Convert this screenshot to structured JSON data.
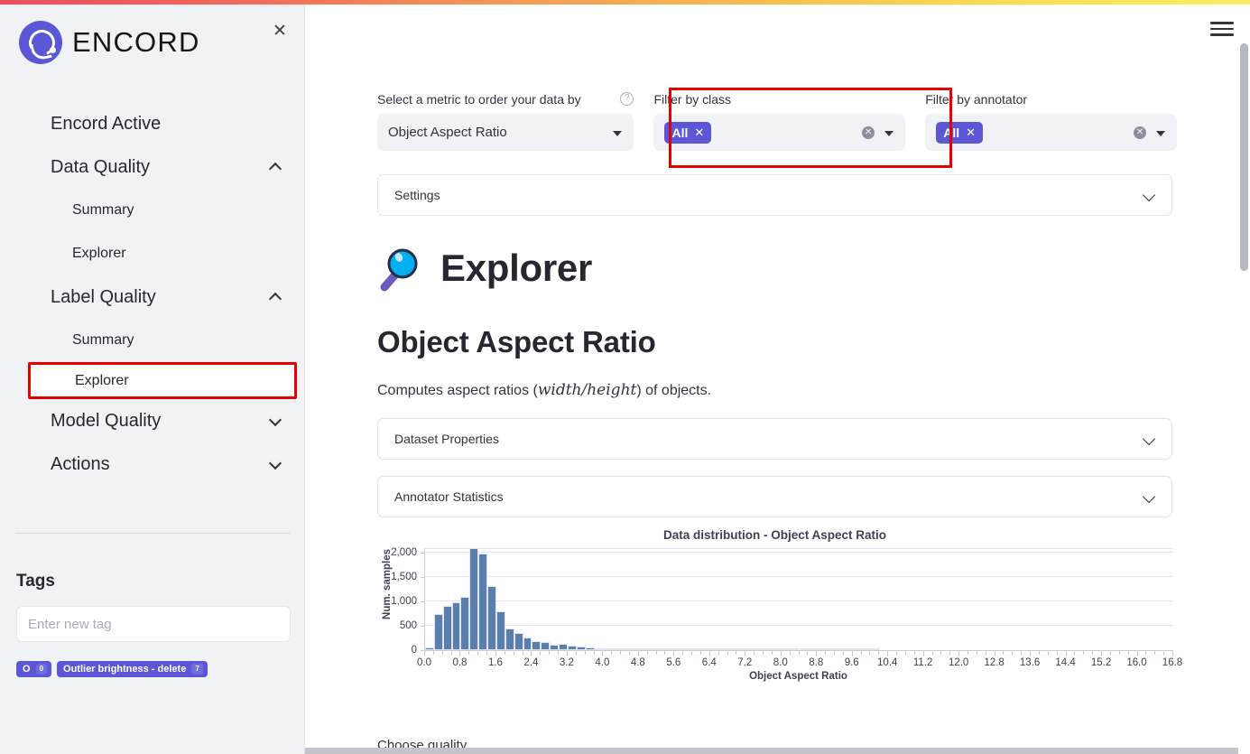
{
  "sidebar": {
    "brand": "ENCORD",
    "close_icon": "close-icon",
    "nav": [
      {
        "label": "Encord Active",
        "type": "group",
        "chevron": "none"
      },
      {
        "label": "Data Quality",
        "type": "group",
        "chevron": "up"
      },
      {
        "label": "Summary",
        "type": "sub"
      },
      {
        "label": "Explorer",
        "type": "sub"
      },
      {
        "label": "Label Quality",
        "type": "group",
        "chevron": "up"
      },
      {
        "label": "Summary",
        "type": "sub"
      },
      {
        "label": "Explorer",
        "type": "sub",
        "selected": true,
        "highlighted": true
      },
      {
        "label": "Model Quality",
        "type": "group",
        "chevron": "down"
      },
      {
        "label": "Actions",
        "type": "group",
        "chevron": "down"
      }
    ],
    "tags": {
      "title": "Tags",
      "input_placeholder": "Enter new tag",
      "input_value": "",
      "pills": [
        {
          "label": "O",
          "count": "0"
        },
        {
          "label": "Outlier brightness - delete",
          "count": "7"
        }
      ]
    }
  },
  "header": {
    "menu_icon": "hamburger-menu-icon"
  },
  "filters": {
    "metric": {
      "label": "Select a metric to order your data by",
      "help_icon": "help-circle-icon",
      "value": "Object Aspect Ratio"
    },
    "by_class": {
      "label": "Filter by class",
      "chip": "All",
      "chip_remove_icon": "close-icon",
      "clear_icon": "clear-circle-icon"
    },
    "by_annotator": {
      "label": "Filter by annotator",
      "chip": "All",
      "chip_remove_icon": "close-icon",
      "clear_icon": "clear-circle-icon"
    }
  },
  "panels": {
    "settings": "Settings",
    "dataset_properties": "Dataset Properties",
    "annotator_statistics": "Annotator Statistics"
  },
  "explorer": {
    "icon": "magnifying-glass-icon",
    "title": "Explorer",
    "metric_title": "Object Aspect Ratio",
    "desc_pre": "Computes aspect ratios (",
    "desc_math": "width/height",
    "desc_post": ") of objects."
  },
  "footer": {
    "choose_quality": "Choose quality"
  },
  "chart_data": {
    "type": "bar",
    "title": "Data distribution - Object Aspect Ratio",
    "xlabel": "Object Aspect Ratio",
    "ylabel": "Num. samples",
    "xlim": [
      0.0,
      16.8
    ],
    "ylim": [
      0,
      2100
    ],
    "yticks": [
      0,
      500,
      1000,
      1500,
      2000
    ],
    "ytick_labels": [
      "0",
      "500",
      "1,000",
      "1,500",
      "2,000"
    ],
    "xticks": [
      0.0,
      0.8,
      1.6,
      2.4,
      3.2,
      4.0,
      4.8,
      5.6,
      6.4,
      7.2,
      8.0,
      8.8,
      9.6,
      10.4,
      11.2,
      12.0,
      12.8,
      13.6,
      14.4,
      15.2,
      16.0,
      16.8
    ],
    "xtick_labels": [
      "0.0",
      "0.8",
      "1.6",
      "2.4",
      "3.2",
      "4.0",
      "4.8",
      "5.6",
      "6.4",
      "7.2",
      "8.0",
      "8.8",
      "9.6",
      "10.4",
      "11.2",
      "12.0",
      "12.8",
      "13.6",
      "14.4",
      "15.2",
      "16.0",
      "16.8"
    ],
    "bin_width": 0.2,
    "bin_starts": [
      0.0,
      0.2,
      0.4,
      0.6,
      0.8,
      1.0,
      1.2,
      1.4,
      1.6,
      1.8,
      2.0,
      2.2,
      2.4,
      2.6,
      2.8,
      3.0,
      3.2,
      3.4,
      3.6,
      3.8,
      4.0,
      4.2,
      4.4,
      4.6,
      4.8,
      5.0,
      5.2,
      5.4,
      5.6,
      5.8,
      6.0,
      6.2,
      6.4,
      6.6,
      6.8,
      7.0,
      7.2,
      7.4,
      7.6,
      7.8,
      8.0,
      8.2,
      8.4,
      8.6,
      8.8,
      9.0,
      9.2,
      9.4,
      9.6,
      9.8,
      10.0
    ],
    "values": [
      55,
      750,
      920,
      985,
      1090,
      2105,
      1995,
      1325,
      800,
      455,
      345,
      255,
      195,
      165,
      120,
      130,
      90,
      70,
      65,
      40,
      45,
      30,
      25,
      20,
      20,
      15,
      20,
      12,
      12,
      10,
      8,
      8,
      8,
      7,
      6,
      6,
      12,
      5,
      5,
      4,
      4,
      3,
      3,
      3,
      3,
      2,
      2,
      2,
      2,
      2,
      2
    ],
    "grid": true,
    "legend": "none",
    "bar_color": "#5a7fae"
  }
}
